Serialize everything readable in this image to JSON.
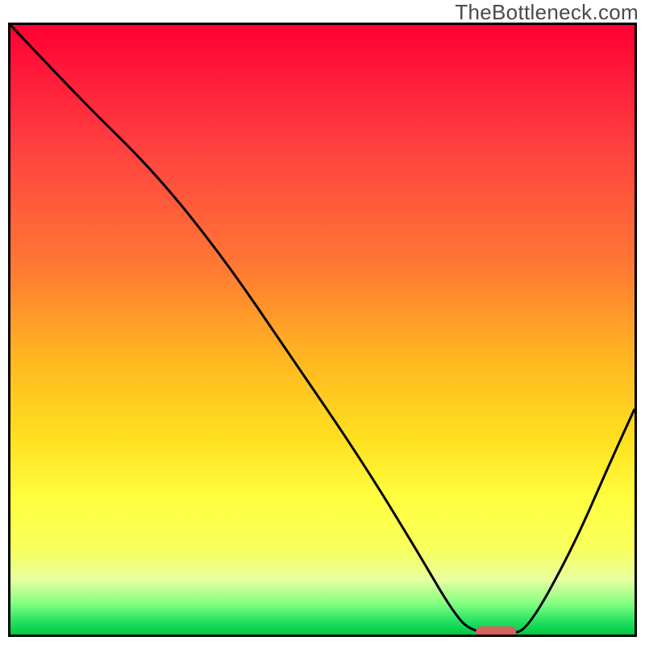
{
  "watermark": "TheBottleneck.com",
  "chart_data": {
    "type": "line",
    "title": "",
    "xlabel": "",
    "ylabel": "",
    "x_range_fraction": [
      0,
      1
    ],
    "y_range_fraction": [
      0,
      1
    ],
    "series": [
      {
        "name": "bottleneck-curve",
        "points_fraction": [
          {
            "x": 0.0,
            "y": 1.0
          },
          {
            "x": 0.11,
            "y": 0.88
          },
          {
            "x": 0.23,
            "y": 0.76
          },
          {
            "x": 0.34,
            "y": 0.62
          },
          {
            "x": 0.45,
            "y": 0.455
          },
          {
            "x": 0.56,
            "y": 0.29
          },
          {
            "x": 0.65,
            "y": 0.14
          },
          {
            "x": 0.71,
            "y": 0.035
          },
          {
            "x": 0.74,
            "y": 0.004
          },
          {
            "x": 0.8,
            "y": 0.0
          },
          {
            "x": 0.83,
            "y": 0.01
          },
          {
            "x": 0.9,
            "y": 0.14
          },
          {
            "x": 0.96,
            "y": 0.28
          },
          {
            "x": 1.0,
            "y": 0.37
          }
        ]
      }
    ],
    "marker": {
      "name": "optimal-region",
      "x_fraction": 0.778,
      "y_fraction": 0.004,
      "color": "#d86060"
    },
    "gradient_stops": [
      {
        "pos": 0.0,
        "color": "#ff0033"
      },
      {
        "pos": 0.4,
        "color": "#ff7a33"
      },
      {
        "pos": 0.78,
        "color": "#ffff40"
      },
      {
        "pos": 1.0,
        "color": "#00c840"
      }
    ]
  }
}
